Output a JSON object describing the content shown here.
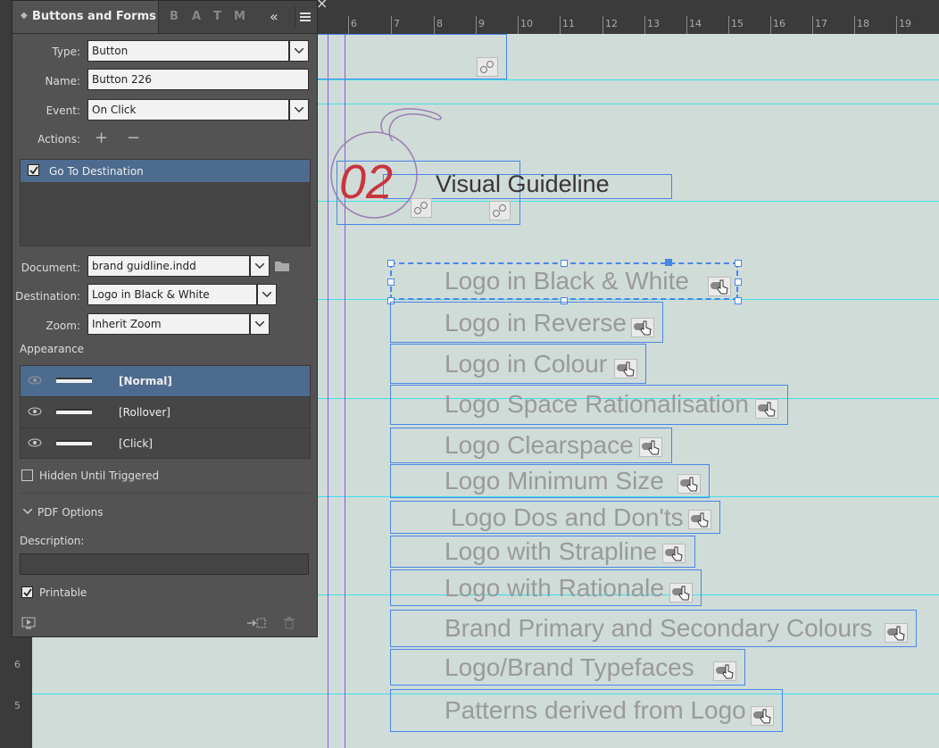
{
  "ruler": {
    "top_labels": [
      "6",
      "7",
      "8",
      "9",
      "10",
      "11",
      "12",
      "13",
      "14",
      "15",
      "16",
      "17",
      "18",
      "19"
    ],
    "left_labels": [
      "6",
      "5"
    ]
  },
  "panel": {
    "title": "Buttons and Forms",
    "tab_letters": [
      "B",
      "A",
      "T",
      "M"
    ],
    "type_label": "Type:",
    "type_value": "Button",
    "name_label": "Name:",
    "name_value": "Button 226",
    "event_label": "Event:",
    "event_value": "On Click",
    "actions_label": "Actions:",
    "actions": [
      {
        "label": "Go To Destination",
        "checked": true
      }
    ],
    "document_label": "Document:",
    "document_value": "brand guidline.indd",
    "destination_label": "Destination:",
    "destination_value": "Logo in Black & White",
    "zoom_label": "Zoom:",
    "zoom_value": "Inherit Zoom",
    "appearance_label": "Appearance",
    "appearance_states": [
      "[Normal]",
      "[Rollover]",
      "[Click]"
    ],
    "hidden_until_triggered_label": "Hidden Until Triggered",
    "pdf_options_label": "PDF Options",
    "description_label": "Description:",
    "description_value": "",
    "printable_label": "Printable"
  },
  "canvas": {
    "section_number": "02",
    "section_title": "Visual Guideline",
    "buttons": [
      "Logo in Black & White",
      "Logo in Reverse",
      "Logo in Colour",
      "Logo Space Rationalisation",
      "Logo Clearspace",
      "Logo Minimum Size",
      "Logo Dos and Don'ts",
      "Logo with Strapline",
      "Logo with Rationale",
      "Brand Primary and Secondary Colours",
      "Logo/Brand Typefaces",
      "Patterns derived from Logo"
    ]
  },
  "colors": {
    "canvas_bg": "#cfdcd8",
    "guide_cyan": "#3fe0e8",
    "guide_purple": "#8b5bd6",
    "frame_blue": "#4a86e8",
    "selection_blue": "#4d6b8e",
    "number_red": "#c9343f"
  }
}
